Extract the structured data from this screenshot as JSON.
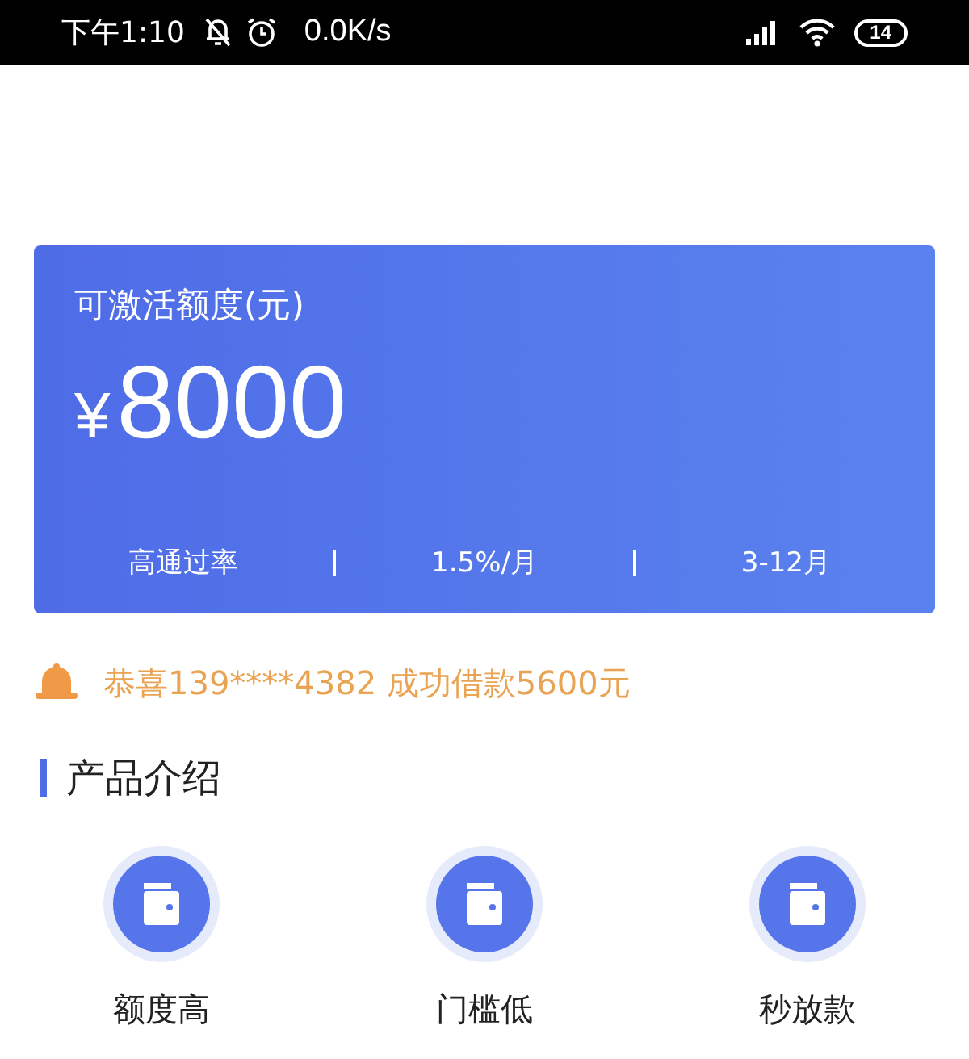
{
  "status_bar": {
    "time": "下午1:10",
    "speed": "0.0K/s",
    "battery": "14"
  },
  "card": {
    "title": "可激活额度(元)",
    "currency": "¥",
    "amount": "8000",
    "stats": [
      "高通过率",
      "1.5%/月",
      "3-12月"
    ]
  },
  "notice": {
    "text": "恭喜139****4382 成功借款5600元"
  },
  "section": {
    "title": "产品介绍"
  },
  "features": [
    {
      "label": "额度高"
    },
    {
      "label": "门槛低"
    },
    {
      "label": "秒放款"
    }
  ]
}
